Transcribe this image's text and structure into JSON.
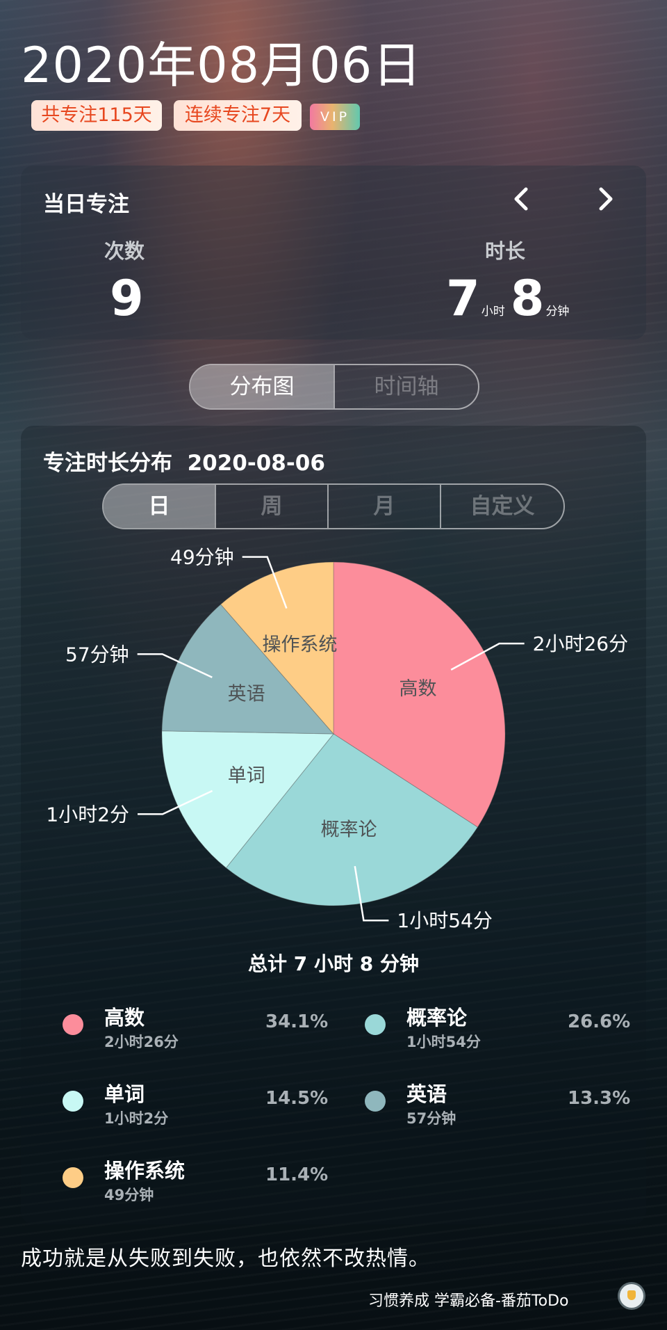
{
  "header": {
    "date_title": "2020年08月06日",
    "badges": [
      "共专注115天",
      "连续专注7天"
    ],
    "vip": "VIP"
  },
  "daily": {
    "title": "当日专注",
    "count_label": "次数",
    "count_value": "9",
    "duration_label": "时长",
    "hours": "7",
    "hours_unit": "小时",
    "minutes": "8",
    "minutes_unit": "分钟"
  },
  "view_tabs": [
    {
      "label": "分布图",
      "active": true
    },
    {
      "label": "时间轴",
      "active": false
    }
  ],
  "distribution": {
    "title": "专注时长分布",
    "date": "2020-08-06",
    "range_tabs": [
      {
        "label": "日",
        "active": true
      },
      {
        "label": "周",
        "active": false
      },
      {
        "label": "月",
        "active": false
      },
      {
        "label": "自定义",
        "active": false
      }
    ],
    "total": "总计 7 小时 8 分钟"
  },
  "chart_data": {
    "type": "pie",
    "categories": [
      "高数",
      "概率论",
      "单词",
      "英语",
      "操作系统"
    ],
    "values": [
      34.1,
      26.6,
      14.5,
      13.3,
      11.4
    ],
    "value_labels": [
      "2小时26分",
      "1小时54分",
      "1小时2分",
      "57分钟",
      "49分钟"
    ],
    "colors": [
      "#fc8d9b",
      "#9ad8d8",
      "#c8f8f4",
      "#8fb7bd",
      "#fecd86"
    ],
    "title": ""
  },
  "legend": [
    {
      "name": "高数",
      "time": "2小时26分",
      "pct": "34.1%",
      "color": "#fc8d9b"
    },
    {
      "name": "概率论",
      "time": "1小时54分",
      "pct": "26.6%",
      "color": "#9ad8d8"
    },
    {
      "name": "单词",
      "time": "1小时2分",
      "pct": "14.5%",
      "color": "#c8f8f4"
    },
    {
      "name": "英语",
      "time": "57分钟",
      "pct": "13.3%",
      "color": "#8fb7bd"
    },
    {
      "name": "操作系统",
      "time": "49分钟",
      "pct": "11.4%",
      "color": "#fecd86"
    }
  ],
  "quote": "成功就是从失败到失败，也依然不改热情。",
  "footer": {
    "text": "习惯养成 学霸必备-番茄ToDo",
    "logo_icon": "tomato-icon"
  }
}
